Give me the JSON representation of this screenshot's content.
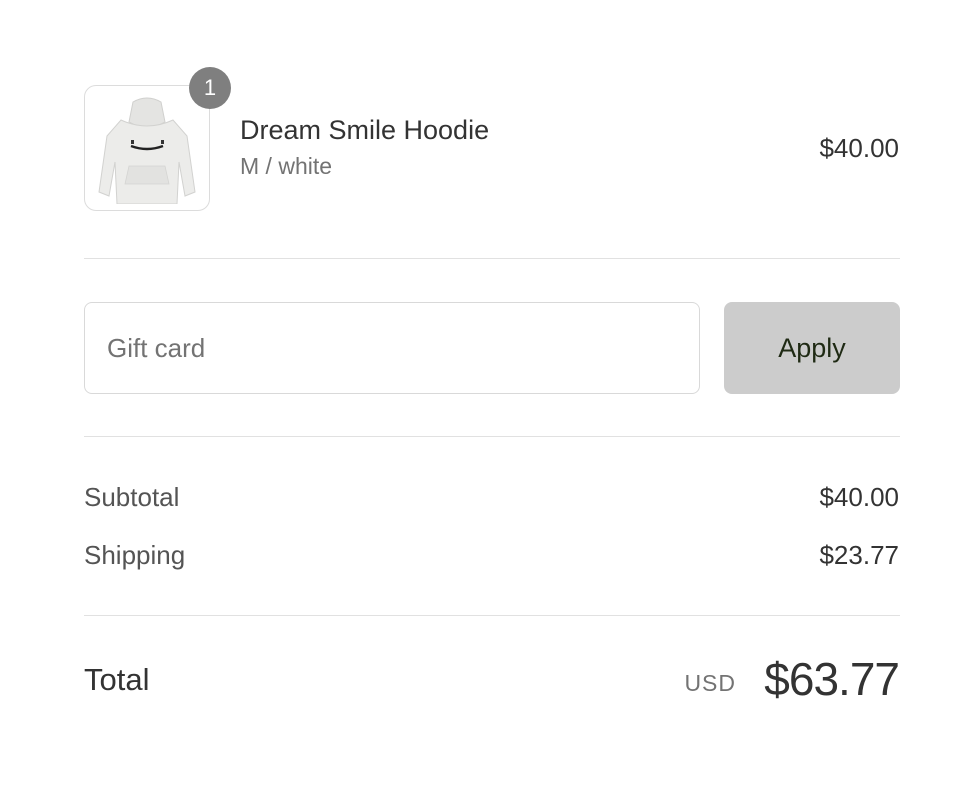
{
  "line_item": {
    "quantity": "1",
    "name": "Dream Smile Hoodie",
    "variant": "M / white",
    "price": "$40.00",
    "image_icon": "hoodie-thumbnail"
  },
  "gift_card": {
    "placeholder": "Gift card",
    "value": "",
    "apply_label": "Apply"
  },
  "costs": {
    "subtotal_label": "Subtotal",
    "subtotal_value": "$40.00",
    "shipping_label": "Shipping",
    "shipping_value": "$23.77"
  },
  "total": {
    "label": "Total",
    "currency": "USD",
    "amount": "$63.77"
  },
  "colors": {
    "badge": "#7f7f7f",
    "apply_button_bg": "#cccccc",
    "apply_button_text": "#1f2a14",
    "divider": "#e1e1e1"
  }
}
